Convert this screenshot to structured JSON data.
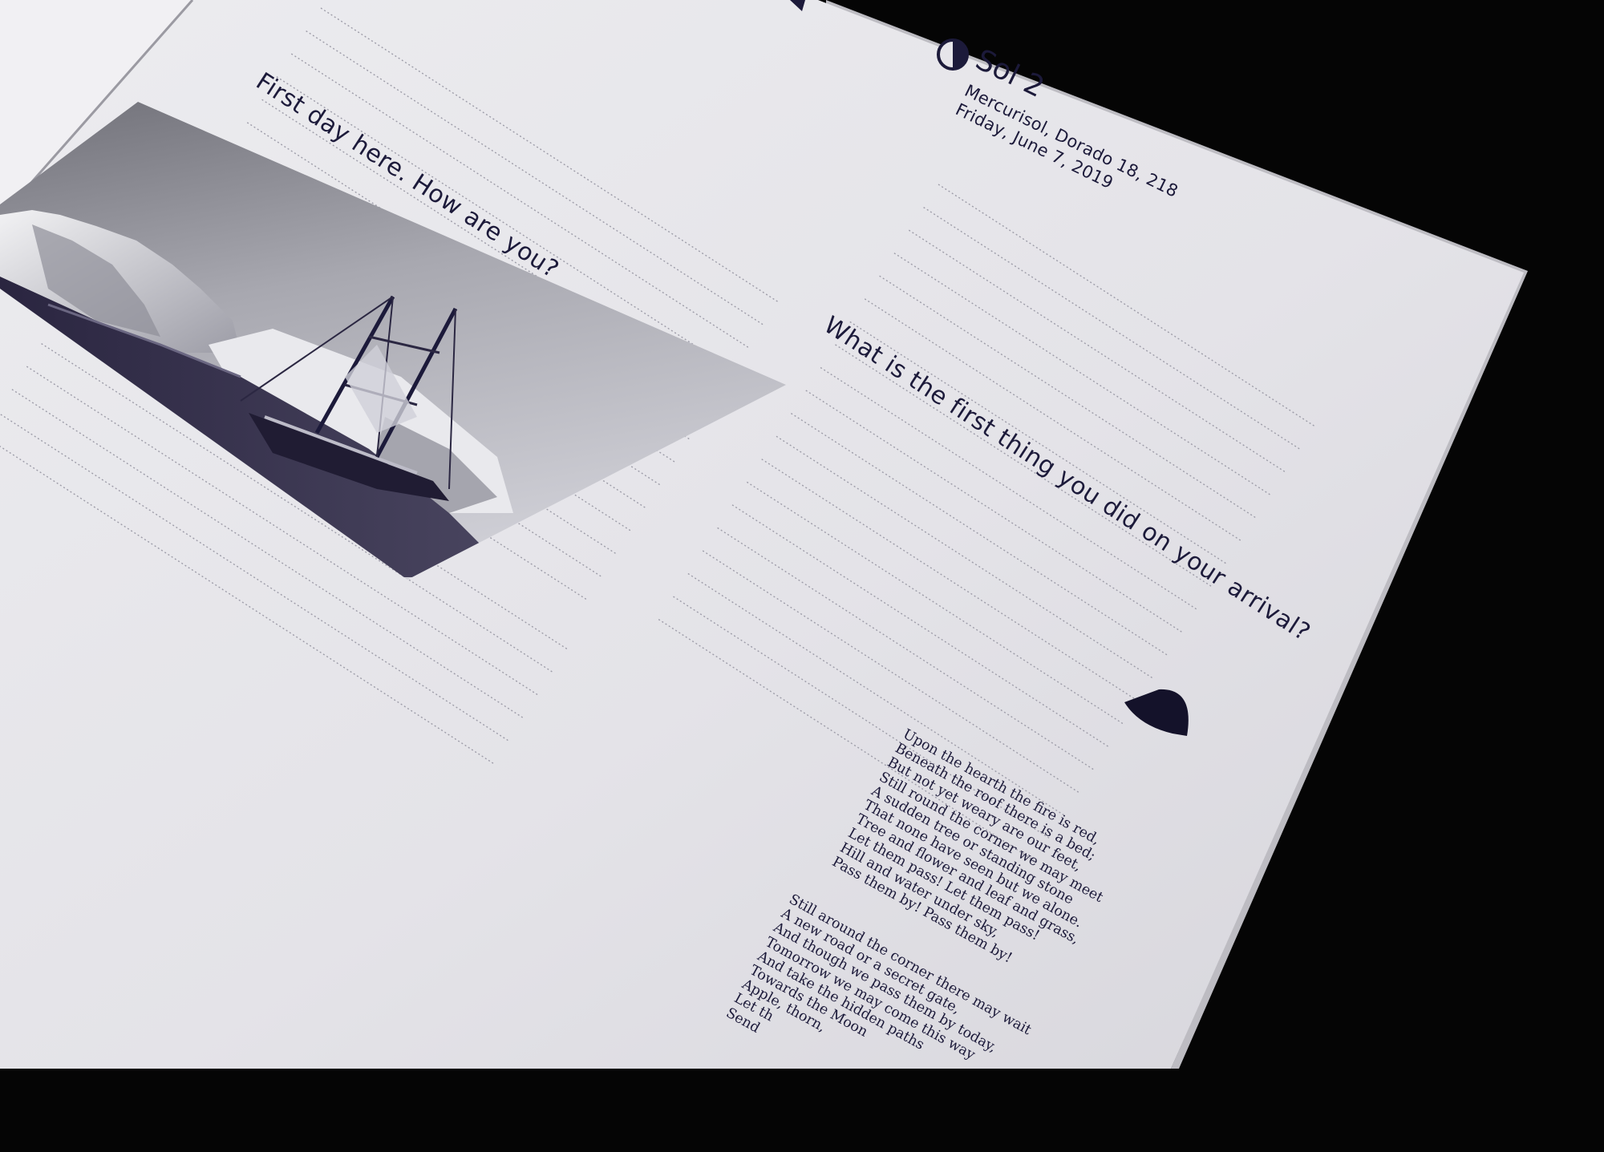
{
  "journal": {
    "day_title": "Sol 2",
    "date_lines": [
      "Mercurisol, Dorado 18, 218",
      "Friday, June 7, 2019"
    ],
    "prompt_left": "First day here. How are you?",
    "prompt_right": "What is the first thing you did on your arrival?"
  },
  "poem": {
    "stanza1": [
      "Upon the hearth the fire is red,",
      "Beneath the roof there is a bed;",
      "But not yet weary are our feet,",
      "Still round the corner we may meet",
      "A sudden tree or standing stone",
      "That none have seen but we alone.",
      "Tree and flower and leaf and grass,",
      "Let them pass! Let them pass!",
      "Hill and water under sky,",
      "Pass them by! Pass them by!"
    ],
    "stanza2": [
      "Still around the corner there may wait",
      "A new road or a secret gate,",
      "And though we pass them by today,",
      "Tomorrow we may come this way",
      "And take the hidden paths",
      "Towards the Moon",
      "Apple, thorn,",
      "Let th",
      "Send"
    ]
  },
  "icons": {
    "moon_phase": "half-moon-icon",
    "shape": "moon-blob-icon"
  },
  "colors": {
    "ink": "#1c1a3a",
    "paper": "#e6e5ea",
    "background": "#050505"
  }
}
